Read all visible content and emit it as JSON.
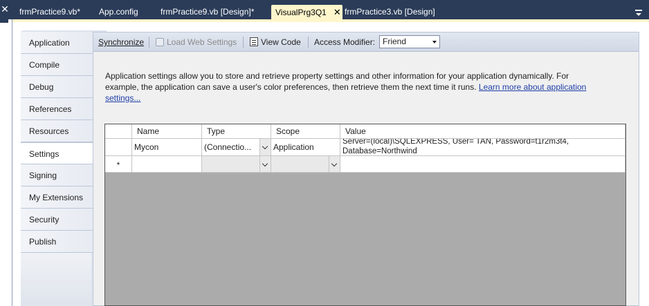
{
  "tabstrip": {
    "close_left": "✕",
    "tabs": [
      {
        "label": "frmPractice9.vb*"
      },
      {
        "label": "App.config"
      },
      {
        "label": "frmPractice9.vb [Design]*"
      },
      {
        "label": "VisualPrg3Q1",
        "active": true,
        "close": "✕"
      },
      {
        "label": "frmPractice3.vb [Design]"
      }
    ]
  },
  "page_tabs": [
    {
      "label": "Application"
    },
    {
      "label": "Compile"
    },
    {
      "label": "Debug"
    },
    {
      "label": "References"
    },
    {
      "label": "Resources"
    },
    {
      "label": "Settings",
      "selected": true
    },
    {
      "label": "Signing"
    },
    {
      "label": "My Extensions"
    },
    {
      "label": "Security"
    },
    {
      "label": "Publish"
    }
  ],
  "toolbar": {
    "synchronize": "Synchronize",
    "load_web_settings": "Load Web Settings",
    "view_code": "View Code",
    "access_modifier_label": "Access Modifier:",
    "access_modifier_value": "Friend"
  },
  "description": {
    "text": "Application settings allow you to store and retrieve property settings and other information for your application dynamically. For example, the application can save a user's color preferences, then retrieve them the next time it runs. ",
    "link": "Learn more about application settings..."
  },
  "grid": {
    "columns": [
      "Name",
      "Type",
      "Scope",
      "Value"
    ],
    "rows": [
      {
        "marker": "",
        "name": "Mycon",
        "type": "(Connectio...",
        "scope": "Application",
        "value_line1": "Server=(local)\\SQLEXPRESS, User= TAN, Password=t1r2m3t4,",
        "value_line2": "Database=Northwind"
      },
      {
        "marker": "*",
        "name": "",
        "type": "",
        "scope": "",
        "value_line1": "",
        "value_line2": ""
      }
    ]
  },
  "colors": {
    "tabstrip_bg": "#2b3c59",
    "active_tab": "#fff6cc",
    "link": "#1f3fa8"
  }
}
